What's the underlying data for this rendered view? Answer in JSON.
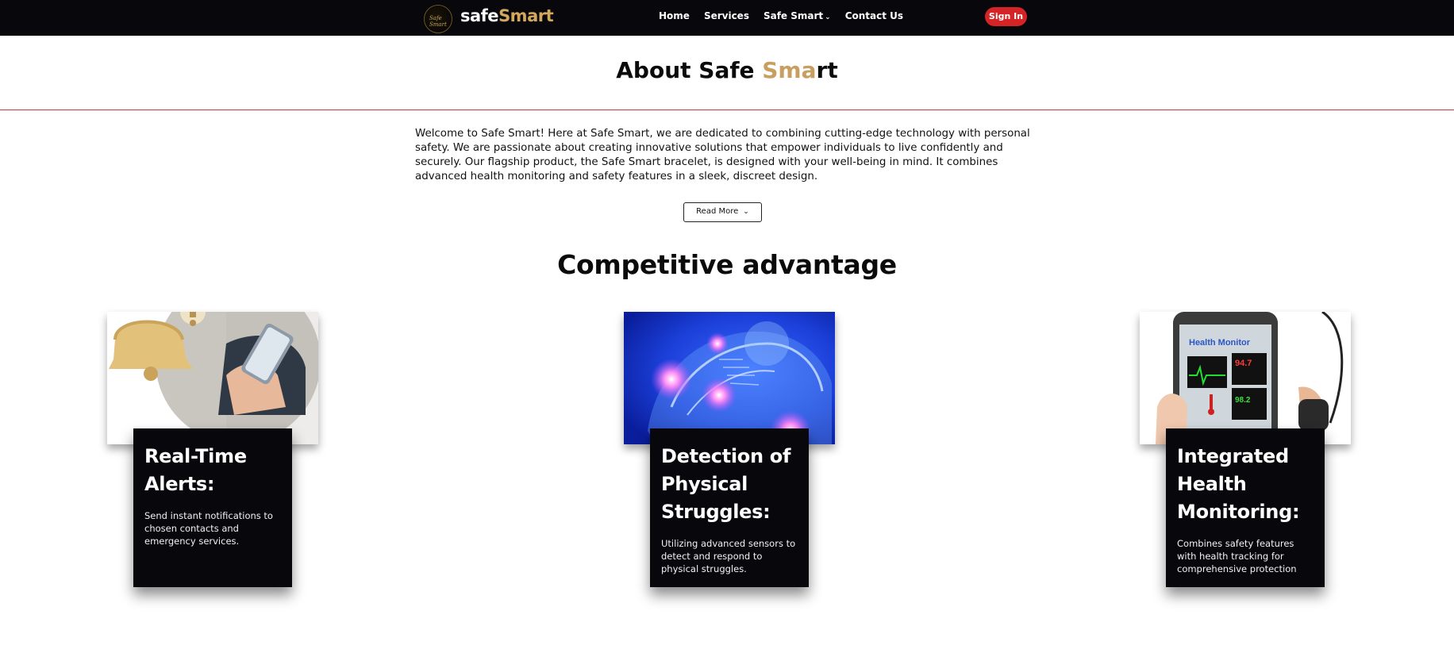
{
  "nav": {
    "logo_text": "Safe Smart",
    "brand_part1": "safe",
    "brand_part2": "Smart",
    "links": [
      {
        "label": "Home"
      },
      {
        "label": "Services"
      },
      {
        "label": "Safe Smart"
      },
      {
        "label": "Contact Us"
      }
    ],
    "signin_label": "Sign In"
  },
  "about": {
    "title_part1": "About Safe ",
    "title_part2": "Sma",
    "title_part3": "rt",
    "body": "Welcome to Safe Smart! Here at Safe Smart, we are dedicated to combining cutting-edge technology with personal safety. We are passionate about creating innovative solutions that empower individuals to live confidently and securely. Our flagship product, the Safe Smart bracelet, is designed with your well-being in mind. It combines advanced health monitoring and safety features in a sleek, discreet design.",
    "read_more_label": "Read More"
  },
  "competitive": {
    "title": "Competitive advantage",
    "cards": [
      {
        "title": "Real-Time Alerts:",
        "desc": "Send instant notifications to chosen contacts and emergency services."
      },
      {
        "title": "Detection of Physical Struggles:",
        "desc": "Utilizing advanced sensors to detect and respond to physical struggles."
      },
      {
        "title": "Integrated Health Monitoring:",
        "desc": "Combines safety features with health tracking for comprehensive protection"
      }
    ]
  },
  "images": {
    "monitor_title": "Health Monitor",
    "readings": [
      "94.7",
      "98.2"
    ]
  },
  "colors": {
    "nav_bg": "#07070c",
    "accent_gold": "#c89f60",
    "accent_red": "#d42426"
  }
}
